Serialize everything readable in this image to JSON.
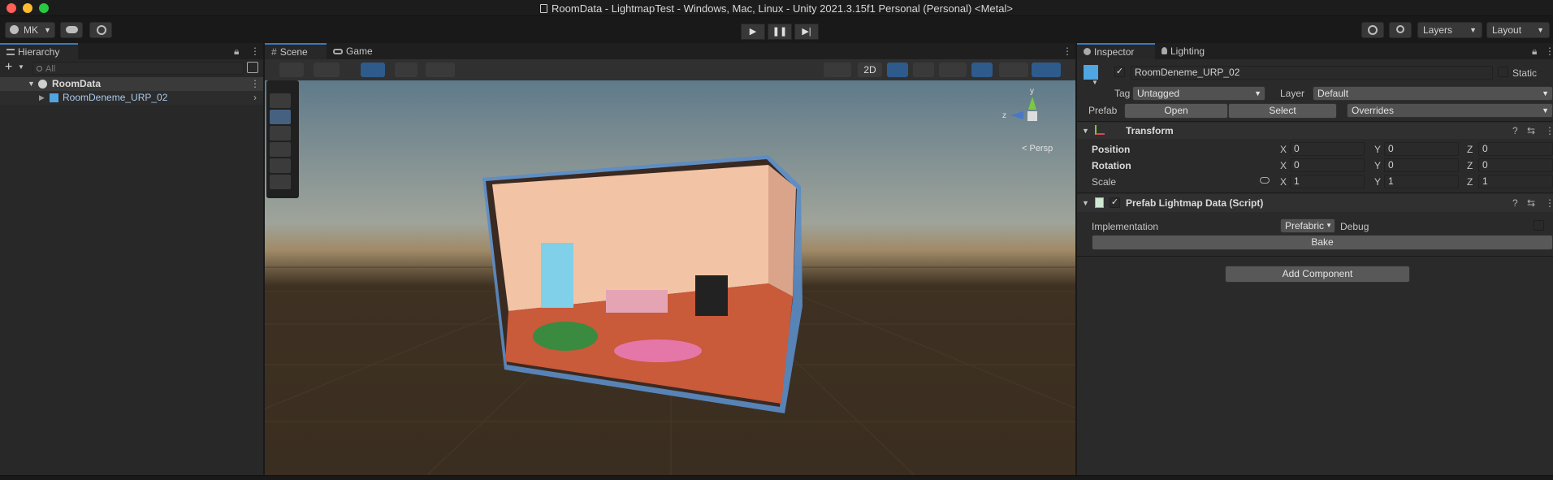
{
  "window": {
    "title": "RoomData - LightmapTest - Windows, Mac, Linux - Unity 2021.3.15f1 Personal (Personal) <Metal>"
  },
  "toolbar": {
    "account_label": "MK",
    "layers_label": "Layers",
    "layout_label": "Layout",
    "icons": [
      "account-icon",
      "cloud-icon",
      "collab-icon",
      "play-icon",
      "pause-icon",
      "step-icon",
      "history-icon",
      "search-icon"
    ]
  },
  "hierarchy": {
    "tab_label": "Hierarchy",
    "search_placeholder": "All",
    "scene_name": "RoomData",
    "items": [
      {
        "label": "RoomDeneme_URP_02"
      }
    ]
  },
  "scene_view": {
    "tabs": [
      {
        "label": "Scene"
      },
      {
        "label": "Game"
      }
    ],
    "mode_2d_label": "2D",
    "gizmo_persp_label": "< Persp",
    "gizmo_axes": {
      "x": "x",
      "y": "y",
      "z": "z"
    },
    "accent_color": "#3a79bb"
  },
  "inspector": {
    "tabs": [
      {
        "label": "Inspector"
      },
      {
        "label": "Lighting"
      }
    ],
    "object_name": "RoomDeneme_URP_02",
    "static_label": "Static",
    "tag_label": "Tag",
    "tag_value": "Untagged",
    "layer_label": "Layer",
    "layer_value": "Default",
    "prefab_label": "Prefab",
    "prefab_open": "Open",
    "prefab_select": "Select",
    "prefab_overrides": "Overrides",
    "transform": {
      "title": "Transform",
      "position_label": "Position",
      "rotation_label": "Rotation",
      "scale_label": "Scale",
      "axis_x": "X",
      "axis_y": "Y",
      "axis_z": "Z",
      "position": {
        "x": "0",
        "y": "0",
        "z": "0"
      },
      "rotation": {
        "x": "0",
        "y": "0",
        "z": "0"
      },
      "scale": {
        "x": "1",
        "y": "1",
        "z": "1"
      }
    },
    "script_component": {
      "title": "Prefab Lightmap Data (Script)",
      "implementation_label": "Implementation",
      "implementation_value": "Prefabric",
      "debug_label": "Debug",
      "bake_label": "Bake"
    },
    "add_component_label": "Add Component"
  }
}
